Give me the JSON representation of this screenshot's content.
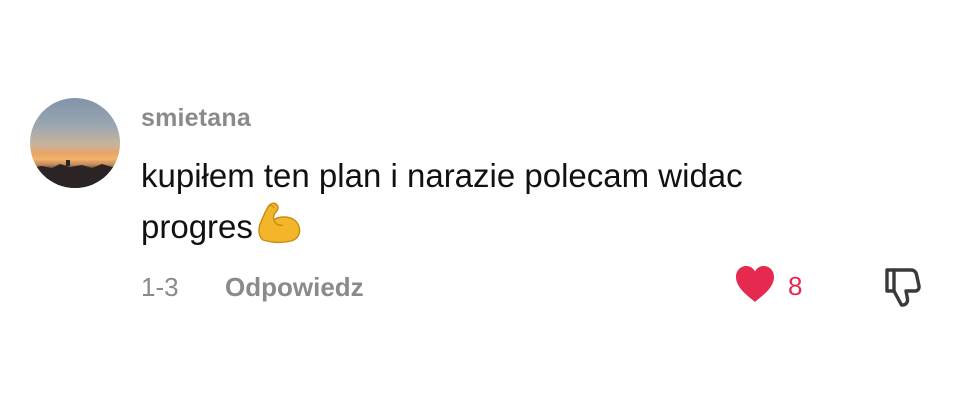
{
  "comment": {
    "username": "smietana",
    "text_line1": "kupiłem ten plan i narazie polecam widac",
    "text_line2": "progres",
    "emoji_icon": "flexed-biceps-icon",
    "date": "1-3",
    "reply_label": "Odpowiedz",
    "like_count": "8",
    "like_icon": "heart-icon",
    "dislike_icon": "thumbs-down-icon",
    "like_color": "#e5294f"
  }
}
